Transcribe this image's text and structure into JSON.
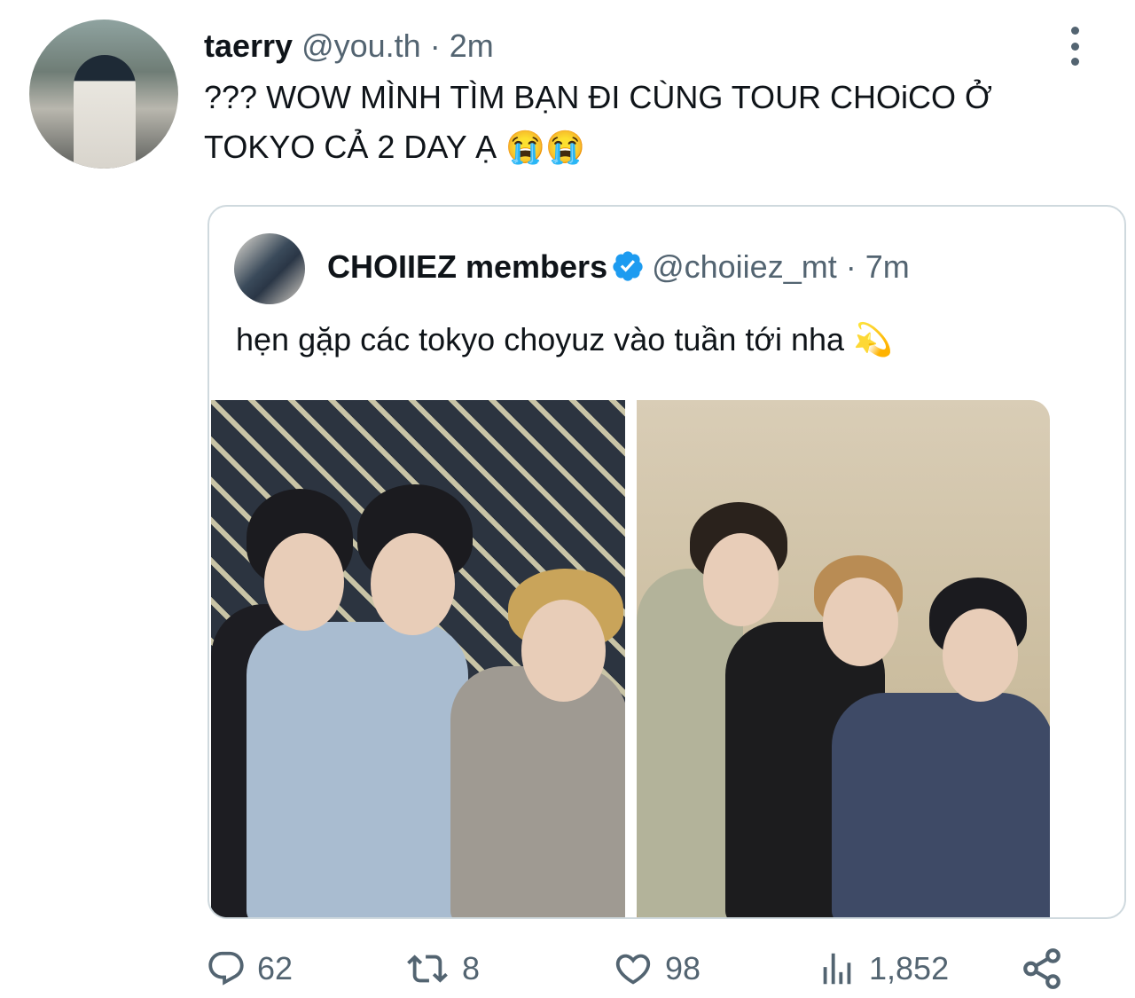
{
  "tweet": {
    "display_name": "taerry",
    "handle": "@you.th",
    "separator": "·",
    "time": "2m",
    "text": "??? WOW MÌNH TÌM BẠN ĐI CÙNG TOUR CHOiCO Ở TOKYO CẢ 2 DAY Ạ 😭😭"
  },
  "quoted": {
    "display_name": "CHOIIEZ members",
    "handle": "@choiiez_mt",
    "separator": "·",
    "time": "7m",
    "text": "hẹn gặp các tokyo choyuz vào tuần tới nha 💫",
    "verified": true,
    "photos": [
      "photo-1",
      "photo-2"
    ]
  },
  "actions": {
    "replies": "62",
    "retweets": "8",
    "likes": "98",
    "views": "1,852"
  },
  "icons": {
    "more": "more-vertical-icon",
    "reply": "reply-icon",
    "retweet": "retweet-icon",
    "like": "heart-icon",
    "views": "views-icon",
    "share": "share-icon",
    "verified": "verified-badge-icon"
  },
  "colors": {
    "text_primary": "#0f1419",
    "text_secondary": "#536471",
    "border": "#cfd9de",
    "verified": "#1d9bf0"
  }
}
